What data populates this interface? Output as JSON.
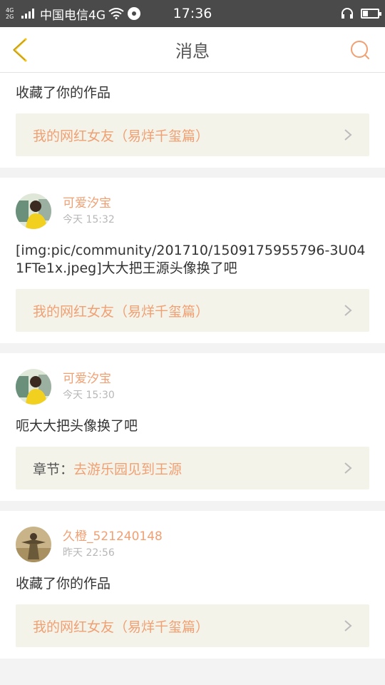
{
  "status_bar": {
    "net_top": "4G",
    "net_bottom": "2G",
    "carrier": "中国电信4G",
    "time": "17:36",
    "battery_level": 0.3
  },
  "nav": {
    "title": "消息",
    "back_icon": "chevron-left-icon",
    "search_icon": "search-icon"
  },
  "colors": {
    "accent": "#f0a073",
    "back_icon": "#f5c518",
    "link_bg": "#f4f3ea"
  },
  "messages": [
    {
      "text": "收藏了你的作品",
      "link": {
        "prefix": "",
        "title": "我的网红女友（易烊千玺篇）"
      }
    },
    {
      "user": "可爱汐宝",
      "time": "今天 15:32",
      "text": "[img:pic/community/201710/1509175955796-3U041FTe1x.jpeg]大大把王源头像换了吧",
      "link": {
        "prefix": "",
        "title": "我的网红女友（易烊千玺篇）"
      }
    },
    {
      "user": "可爱汐宝",
      "time": "今天 15:30",
      "text": "呃大大把头像换了吧",
      "link": {
        "prefix": "章节：",
        "title": "去游乐园见到王源"
      }
    },
    {
      "user": "久橙_521240148",
      "time": "昨天 22:56",
      "text": "收藏了你的作品",
      "link": {
        "prefix": "",
        "title": "我的网红女友（易烊千玺篇）"
      }
    }
  ]
}
